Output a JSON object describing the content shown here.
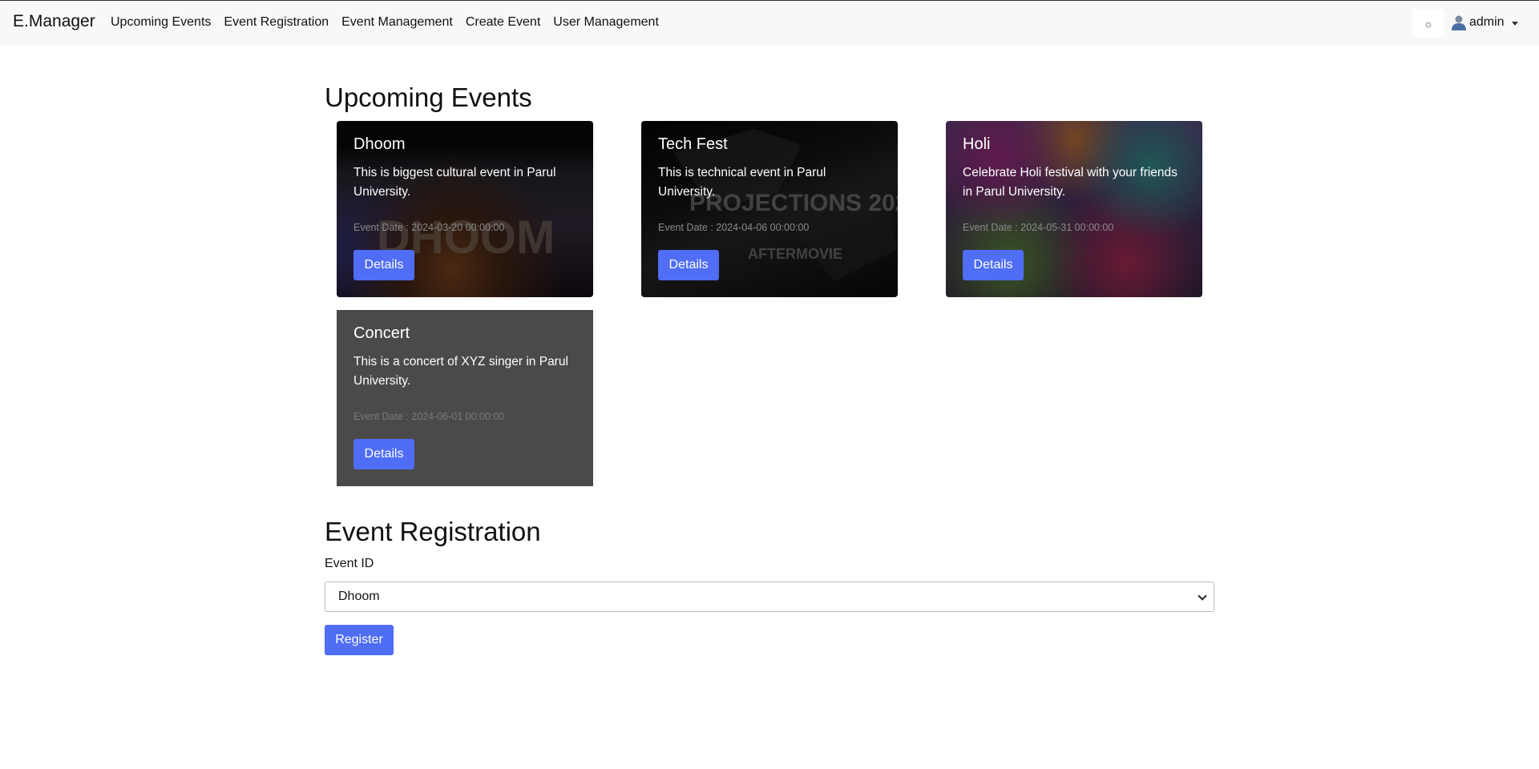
{
  "navbar": {
    "brand": "E.Manager",
    "links": [
      "Upcoming Events",
      "Event Registration",
      "Event Management",
      "Create Event",
      "User Management"
    ],
    "theme_toggle_icon": "sun-icon",
    "theme_toggle_glyph": "☼",
    "user_icon": "user-icon",
    "user_label": "admin"
  },
  "upcoming": {
    "title": "Upcoming Events",
    "events": [
      {
        "title": "Dhoom",
        "description": "This is biggest cultural event in Parul University.",
        "date": "Event Date : 2024-03-20 00:00:00",
        "button": "Details",
        "bg_color": "#2a2a3a"
      },
      {
        "title": "Tech Fest",
        "description": "This is technical event in Parul University.",
        "date": "Event Date : 2024-04-06 00:00:00",
        "button": "Details",
        "bg_color": "#1a1a1a"
      },
      {
        "title": "Holi",
        "description": "Celebrate Holi festival with your friends in Parul University.",
        "date": "Event Date : 2024-05-31 00:00:00",
        "button": "Details",
        "bg_color": "#5a3a6a"
      },
      {
        "title": "Concert",
        "description": "This is a concert of XYZ singer in Parul University.",
        "date": "Event Date : 2024-06-01 00:00:00",
        "button": "Details",
        "bg_color": "#4a4a4a"
      }
    ]
  },
  "registration": {
    "title": "Event Registration",
    "field_label": "Event ID",
    "selected_event": "Dhoom",
    "submit_label": "Register"
  },
  "colors": {
    "accent": "#4f6df5",
    "navbar_bg": "#f8f8f8"
  }
}
